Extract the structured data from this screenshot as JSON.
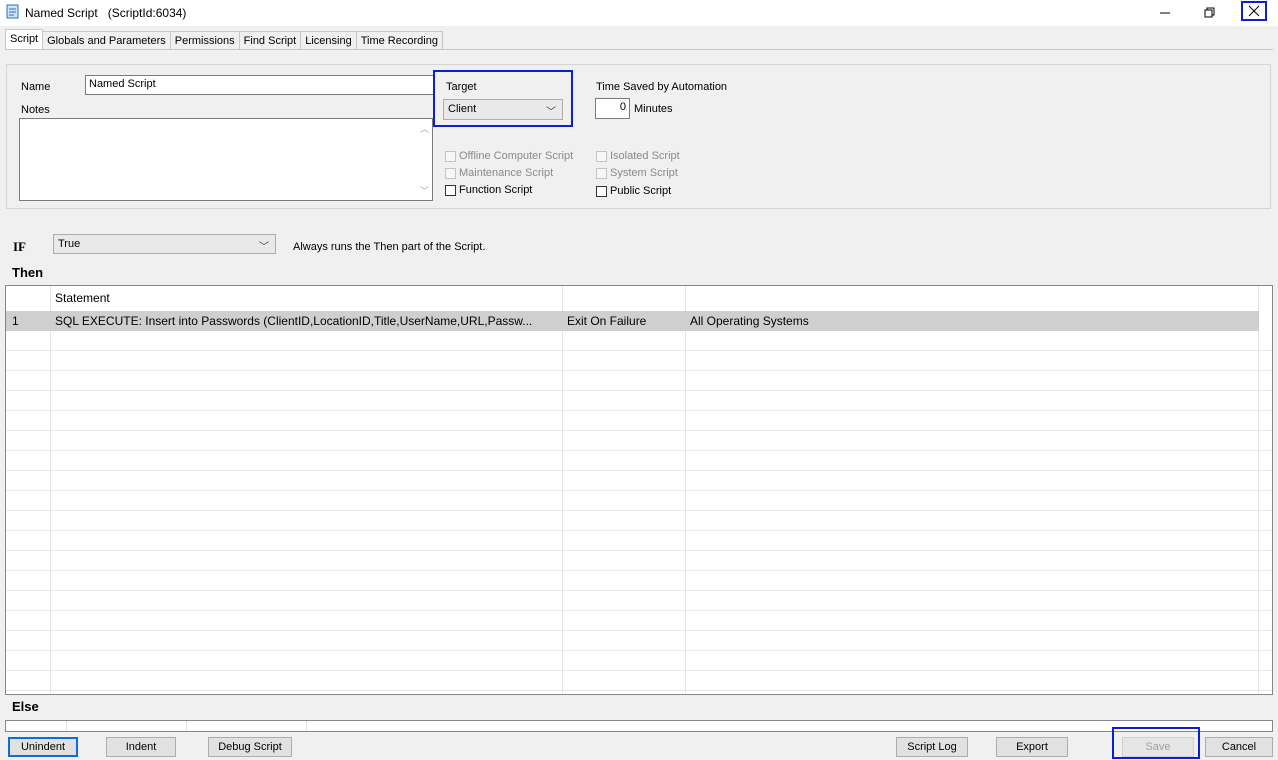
{
  "window": {
    "title": "Named Script",
    "script_id": "(ScriptId:6034)"
  },
  "icons": {
    "app": "script-icon",
    "minimize": "minimize-icon",
    "restore": "restore-icon",
    "close": "close-icon"
  },
  "tabs": [
    "Script",
    "Globals and Parameters",
    "Permissions",
    "Find Script",
    "Licensing",
    "Time Recording"
  ],
  "form": {
    "name_label": "Name",
    "name_value": "Named Script",
    "notes_label": "Notes",
    "notes_value": "",
    "target_label": "Target",
    "target_value": "Client",
    "time_saved_label": "Time Saved by Automation",
    "time_saved_value": "0",
    "minutes_label": "Minutes"
  },
  "checkboxes": {
    "offline": "Offline Computer Script",
    "maintenance": "Maintenance Script",
    "function": "Function Script",
    "isolated": "Isolated Script",
    "system": "System Script",
    "public": "Public Script"
  },
  "condition": {
    "if_label": "IF",
    "if_value": "True",
    "description": "Always runs the Then part of the Script.",
    "then_label": "Then",
    "else_label": "Else"
  },
  "then_table": {
    "headers": [
      "",
      "Statement",
      "",
      ""
    ],
    "rows": [
      {
        "num": "1",
        "statement": "SQL EXECUTE: Insert into Passwords (ClientID,LocationID,Title,UserName,URL,Passw...",
        "failure": "Exit On Failure",
        "os": "All Operating Systems"
      }
    ]
  },
  "buttons": {
    "unindent": "Unindent",
    "indent": "Indent",
    "debug": "Debug Script",
    "script_log": "Script Log",
    "export": "Export",
    "save": "Save",
    "cancel": "Cancel"
  },
  "colors": {
    "highlight": "#0a1fd6",
    "selected_row": "#cfcfcf"
  }
}
